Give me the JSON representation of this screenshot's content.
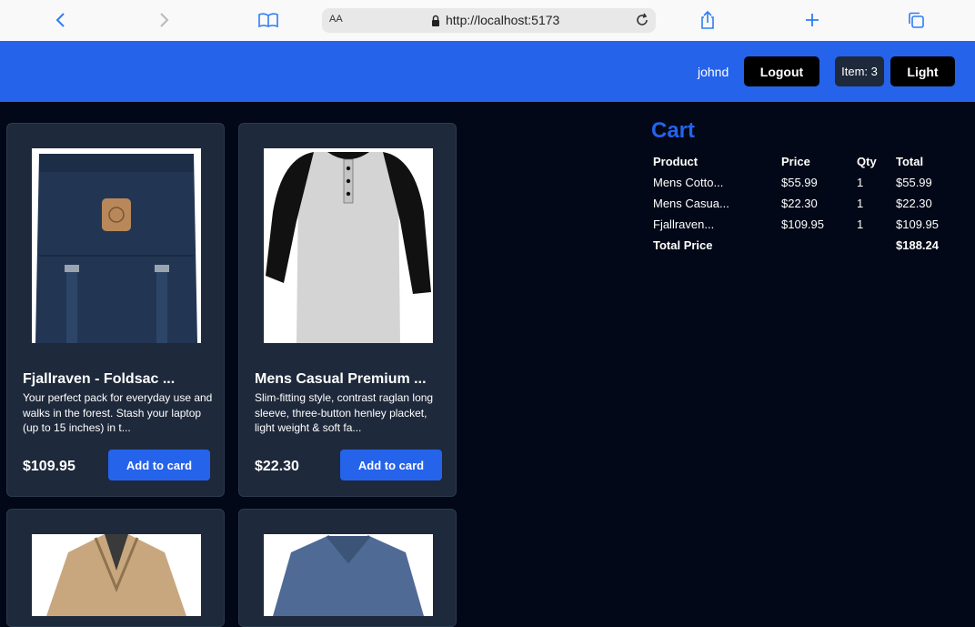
{
  "browser": {
    "text_size_label": "AA",
    "url": "http://localhost:5173"
  },
  "header": {
    "username": "johnd",
    "logout_label": "Logout",
    "items_label": "Item: 3",
    "theme_label": "Light",
    "accent_color": "#2563eb"
  },
  "products": [
    {
      "title": "Fjallraven - Foldsac ...",
      "description": "Your perfect pack for everyday use and walks in the forest. Stash your laptop (up to 15 inches) in t...",
      "price": "$109.95",
      "button_label": "Add to card"
    },
    {
      "title": "Mens Casual Premium ...",
      "description": "Slim-fitting style, contrast raglan long sleeve, three-button henley placket, light weight & soft fa...",
      "price": "$22.30",
      "button_label": "Add to card"
    }
  ],
  "cart": {
    "title": "Cart",
    "headers": [
      "Product",
      "Price",
      "Qty",
      "Total"
    ],
    "rows": [
      [
        "Mens Cotto...",
        "$55.99",
        "1",
        "$55.99"
      ],
      [
        "Mens Casua...",
        "$22.30",
        "1",
        "$22.30"
      ],
      [
        "Fjallraven...",
        "$109.95",
        "1",
        "$109.95"
      ]
    ],
    "total_label": "Total Price",
    "total_value": "$188.24"
  }
}
